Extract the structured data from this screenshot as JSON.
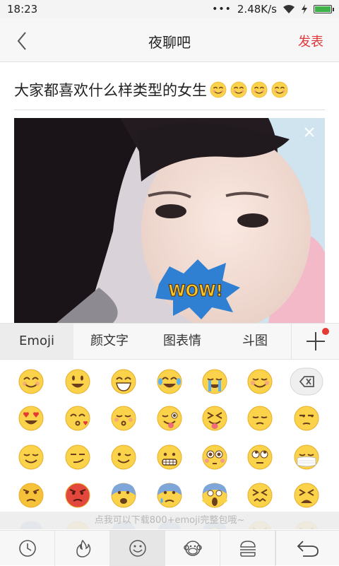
{
  "status": {
    "time": "18:23",
    "network_speed": "2.48K/s"
  },
  "nav": {
    "title": "夜聊吧",
    "publish_label": "发表"
  },
  "post": {
    "title": "大家都喜欢什么样类型的女生",
    "title_emojis": 4,
    "image_sticker_text": "WOW!"
  },
  "keyboard": {
    "tabs": [
      {
        "label": "Emoji",
        "active": true
      },
      {
        "label": "颜文字",
        "active": false
      },
      {
        "label": "图表情",
        "active": false
      },
      {
        "label": "斗图",
        "active": false
      }
    ],
    "add_tab_badge": true,
    "emoji_rows": [
      [
        "smile",
        "grin",
        "big-grin",
        "laugh-cry",
        "loud-cry",
        "blush"
      ],
      [
        "heart-eyes",
        "kiss-heart",
        "kiss-closed",
        "wink-tongue",
        "squint-tongue",
        "pensive",
        "unamused"
      ],
      [
        "relieved",
        "smirk",
        "wink",
        "grimace",
        "flushed",
        "eye-roll",
        "mask"
      ],
      [
        "angry",
        "rage",
        "fearful",
        "cold-sweat",
        "scream",
        "confounded",
        "tired"
      ]
    ],
    "hint": "点我可以下载800+emoji完整包哦~",
    "categories": [
      "recent-icon",
      "fire-icon",
      "smiley-icon",
      "monkey-icon",
      "burger-icon"
    ],
    "active_category": 2
  }
}
